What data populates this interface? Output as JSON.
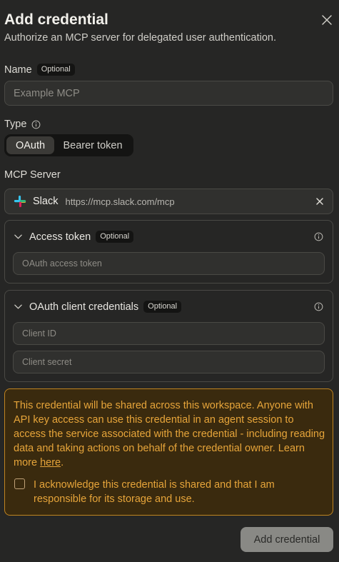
{
  "dialog": {
    "title": "Add credential",
    "subtitle": "Authorize an MCP server for delegated user authentication."
  },
  "name_field": {
    "label": "Name",
    "badge": "Optional",
    "placeholder": "Example MCP",
    "value": ""
  },
  "type_field": {
    "label": "Type",
    "options": [
      "OAuth",
      "Bearer token"
    ],
    "selected": "OAuth"
  },
  "mcp_server": {
    "label": "MCP Server",
    "name": "Slack",
    "url": "https://mcp.slack.com/mcp"
  },
  "access_token": {
    "title": "Access token",
    "badge": "Optional",
    "placeholder": "OAuth access token"
  },
  "client_credentials": {
    "title": "OAuth client credentials",
    "badge": "Optional",
    "client_id_placeholder": "Client ID",
    "client_secret_placeholder": "Client secret"
  },
  "warning": {
    "text": "This credential will be shared across this workspace. Anyone with API key access can use this credential in an agent session to access the service associated with the credential - including reading data and taking actions on behalf of the credential owner. Learn more ",
    "link_text": "here",
    "suffix": ".",
    "acknowledge": "I acknowledge this credential is shared and that I am responsible for its storage and use.",
    "acknowledged": false
  },
  "actions": {
    "submit_label": "Add credential"
  },
  "colors": {
    "background": "#262625",
    "warning_text": "#e7a53a",
    "warning_border": "#c08420",
    "warning_bg": "#3a2a0e"
  },
  "icons": [
    "close-icon",
    "info-icon",
    "slack-logo",
    "chevron-down-icon"
  ]
}
